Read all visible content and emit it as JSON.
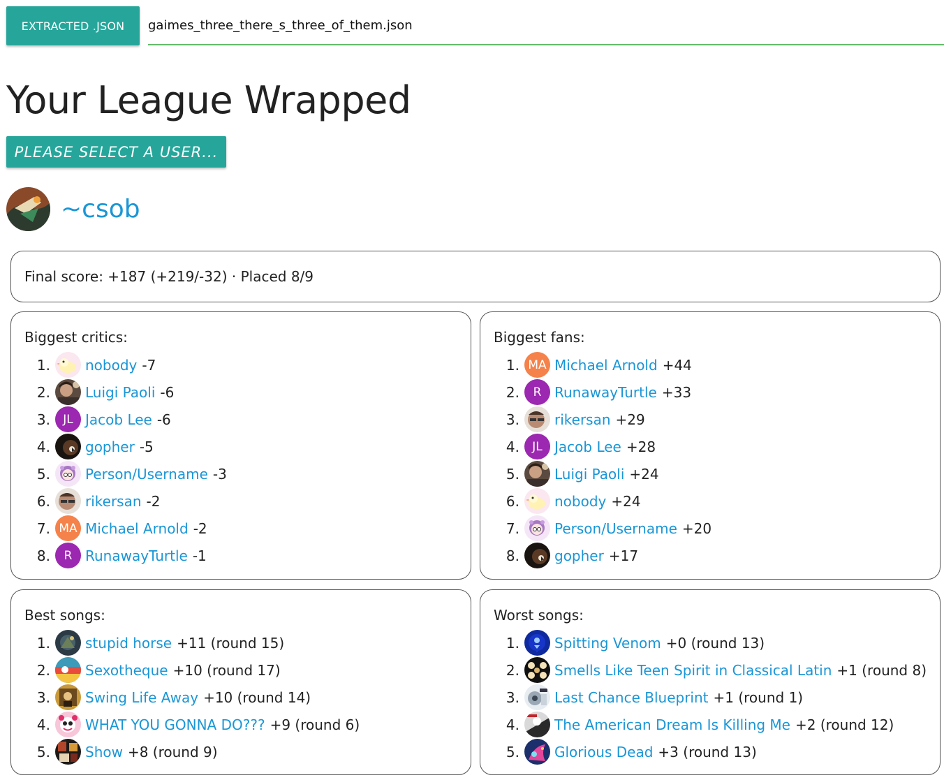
{
  "file_input": {
    "button_label": "EXTRACTED .JSON",
    "value": "gaimes_three_there_s_three_of_them.json"
  },
  "title": "Your League Wrapped",
  "user_select_label": "PLEASE SELECT A USER...",
  "user": {
    "name": "~csob"
  },
  "summary": {
    "text": "Final score: +187 (+219/-32) · Placed 8/9"
  },
  "colors": {
    "accent": "#26a69a",
    "link": "#1a96d6",
    "underline": "#66bb6a",
    "purple": "#9c27b0",
    "orange": "#f4824a"
  },
  "critics": {
    "title": "Biggest critics:",
    "items": [
      {
        "rank": "1.",
        "name": "nobody",
        "value": "-7"
      },
      {
        "rank": "2.",
        "name": "Luigi Paoli",
        "value": "-6"
      },
      {
        "rank": "3.",
        "name": "Jacob Lee",
        "value": "-6",
        "initials": "JL"
      },
      {
        "rank": "4.",
        "name": "gopher",
        "value": "-5"
      },
      {
        "rank": "5.",
        "name": "Person/Username",
        "value": "-3"
      },
      {
        "rank": "6.",
        "name": "rikersan",
        "value": "-2"
      },
      {
        "rank": "7.",
        "name": "Michael Arnold",
        "value": "-2",
        "initials": "MA"
      },
      {
        "rank": "8.",
        "name": "RunawayTurtle",
        "value": "-1",
        "initials": "R"
      }
    ]
  },
  "fans": {
    "title": "Biggest fans:",
    "items": [
      {
        "rank": "1.",
        "name": "Michael Arnold",
        "value": "+44",
        "initials": "MA"
      },
      {
        "rank": "2.",
        "name": "RunawayTurtle",
        "value": "+33",
        "initials": "R"
      },
      {
        "rank": "3.",
        "name": "rikersan",
        "value": "+29"
      },
      {
        "rank": "4.",
        "name": "Jacob Lee",
        "value": "+28",
        "initials": "JL"
      },
      {
        "rank": "5.",
        "name": "Luigi Paoli",
        "value": "+24"
      },
      {
        "rank": "6.",
        "name": "nobody",
        "value": "+24"
      },
      {
        "rank": "7.",
        "name": "Person/Username",
        "value": "+20"
      },
      {
        "rank": "8.",
        "name": "gopher",
        "value": "+17"
      }
    ]
  },
  "best_songs": {
    "title": "Best songs:",
    "items": [
      {
        "rank": "1.",
        "name": "stupid horse",
        "value": "+11 (round 15)"
      },
      {
        "rank": "2.",
        "name": "Sexotheque",
        "value": "+10 (round 17)"
      },
      {
        "rank": "3.",
        "name": "Swing Life Away",
        "value": "+10 (round 14)"
      },
      {
        "rank": "4.",
        "name": "WHAT YOU GONNA DO???",
        "value": "+9 (round 6)"
      },
      {
        "rank": "5.",
        "name": "Show",
        "value": "+8 (round 9)"
      }
    ]
  },
  "worst_songs": {
    "title": "Worst songs:",
    "items": [
      {
        "rank": "1.",
        "name": "Spitting Venom",
        "value": "+0 (round 13)"
      },
      {
        "rank": "2.",
        "name": "Smells Like Teen Spirit in Classical Latin",
        "value": "+1 (round 8)"
      },
      {
        "rank": "3.",
        "name": "Last Chance Blueprint",
        "value": "+1 (round 1)"
      },
      {
        "rank": "4.",
        "name": "The American Dream Is Killing Me",
        "value": "+2 (round 12)"
      },
      {
        "rank": "5.",
        "name": "Glorious Dead",
        "value": "+3 (round 13)"
      }
    ]
  }
}
